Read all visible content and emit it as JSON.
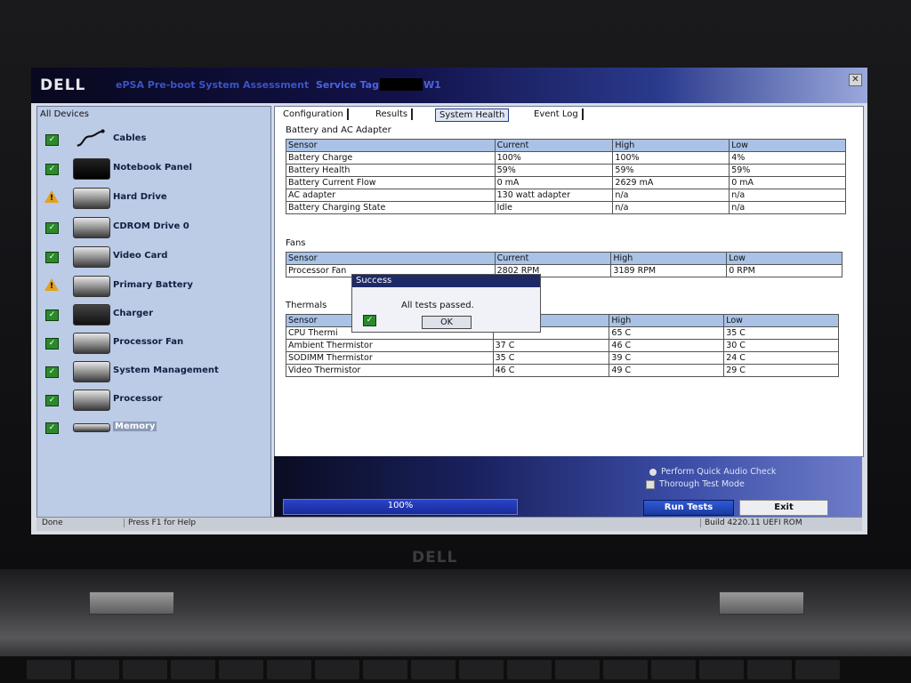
{
  "window": {
    "logo": "DELL",
    "app_title": "ePSA Pre-boot System Assessment",
    "service_tag_label": "Service Tag",
    "service_tag_suffix": "W1",
    "close_glyph": "✕"
  },
  "bezel_logo": "DELL",
  "sidebar": {
    "title": "All Devices",
    "items": [
      {
        "label": "Cables",
        "status": "pass",
        "icon": "cable-icon"
      },
      {
        "label": "Notebook Panel",
        "status": "pass",
        "icon": "notebook-panel-icon"
      },
      {
        "label": "Hard Drive",
        "status": "warning",
        "icon": "hard-drive-icon"
      },
      {
        "label": "CDROM Drive 0",
        "status": "pass",
        "icon": "cdrom-drive-icon"
      },
      {
        "label": "Video Card",
        "status": "pass",
        "icon": "video-card-icon"
      },
      {
        "label": "Primary Battery",
        "status": "warning",
        "icon": "battery-icon"
      },
      {
        "label": "Charger",
        "status": "pass",
        "icon": "charger-icon"
      },
      {
        "label": "Processor Fan",
        "status": "pass",
        "icon": "fan-icon"
      },
      {
        "label": "System Management",
        "status": "pass",
        "icon": "system-management-icon"
      },
      {
        "label": "Processor",
        "status": "pass",
        "icon": "processor-icon"
      },
      {
        "label": "Memory",
        "status": "pass",
        "icon": "memory-icon",
        "selected": true
      }
    ]
  },
  "tabs": [
    {
      "label": "Configuration"
    },
    {
      "label": "Results"
    },
    {
      "label": "System Health",
      "active": true
    },
    {
      "label": "Event Log"
    }
  ],
  "battery": {
    "title": "Battery and AC Adapter",
    "headers": [
      "Sensor",
      "Current",
      "High",
      "Low"
    ],
    "rows": [
      [
        "Battery Charge",
        "100%",
        "100%",
        "4%"
      ],
      [
        "Battery Health",
        "59%",
        "59%",
        "59%"
      ],
      [
        "Battery Current Flow",
        "0 mA",
        "2629 mA",
        "0 mA"
      ],
      [
        "AC adapter",
        "130 watt adapter",
        "n/a",
        "n/a"
      ],
      [
        "Battery Charging State",
        "Idle",
        "n/a",
        "n/a"
      ]
    ]
  },
  "fans": {
    "title": "Fans",
    "headers": [
      "Sensor",
      "Current",
      "High",
      "Low"
    ],
    "rows": [
      [
        "Processor Fan",
        "2802 RPM",
        "3189 RPM",
        "0 RPM"
      ]
    ]
  },
  "thermals": {
    "title": "Thermals",
    "headers": [
      "Sensor",
      "",
      "High",
      "Low"
    ],
    "rows": [
      [
        "CPU Thermi",
        "",
        "65 C",
        "35 C"
      ],
      [
        "Ambient Thermistor",
        "37 C",
        "46 C",
        "30 C"
      ],
      [
        "SODIMM Thermistor",
        "35 C",
        "39 C",
        "24 C"
      ],
      [
        "Video Thermistor",
        "46 C",
        "49 C",
        "29 C"
      ]
    ]
  },
  "dialog": {
    "title": "Success",
    "message": "All tests passed.",
    "ok_label": "OK"
  },
  "footer": {
    "progress_text": "100%",
    "progress_fraction": 1.0,
    "opt_audio": "Perform Quick Audio Check",
    "opt_thorough": "Thorough Test Mode",
    "run_label": "Run Tests",
    "exit_label": "Exit"
  },
  "status": {
    "left": "Done",
    "help": "Press F1 for Help",
    "build": "Build  4220.11 UEFI ROM"
  }
}
